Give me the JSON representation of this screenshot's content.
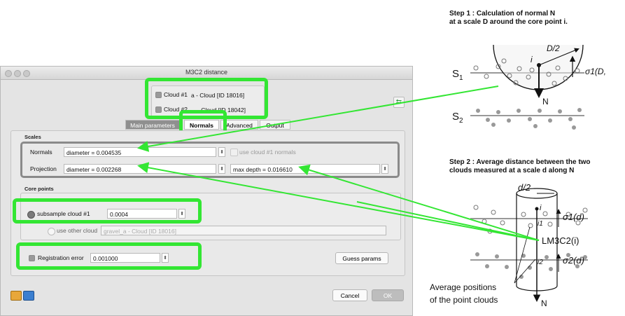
{
  "dialog": {
    "title": "M3C2 distance",
    "cloud1_label": "Cloud #1",
    "cloud1_value": "a - Cloud [ID 18016]",
    "cloud2_label": "Cloud #2",
    "cloud2_value": "- Cloud [ID 18042]",
    "tabs": [
      "Main parameters",
      "Normals",
      "Advanced",
      "Output"
    ],
    "scales_heading": "Scales",
    "normals_label": "Normals",
    "normals_value": "diameter = 0.004535",
    "use_cloud_normals": "use cloud #1 normals",
    "projection_label": "Projection",
    "projection_value": "diameter = 0.002268",
    "max_depth_value": "max depth = 0.016610",
    "core_points_heading": "Core points",
    "subsample_label": "subsample cloud #1",
    "subsample_value": "0.0004",
    "use_other_cloud_label": "use other cloud",
    "other_cloud_value": "gravel_a - Cloud [ID 18016]",
    "registration_label": "Registration error",
    "registration_value": "0.001000",
    "guess_params_button": "Guess params",
    "cancel_button": "Cancel",
    "ok_button": "OK"
  },
  "figure": {
    "step1_line1": "Step 1 : Calculation of normal N",
    "step1_line2": "at a scale D around the core point i.",
    "step2_line1": "Step 2 : Average distance between the two",
    "step2_line2": "clouds measured at a scale d along N",
    "s1": "S",
    "s1_sub": "1",
    "s2": "S",
    "s2_sub": "2",
    "d_half_big": "D/2",
    "sigma1_big": "σ1(D,",
    "n_big": "N",
    "i_big": "i",
    "d_half_small": "d/2",
    "i_small": "i",
    "i1": "i1",
    "i2": "i2",
    "sigma1_small": "σ1(d)",
    "sigma2_small": "σ2(d)",
    "lm3c2": "LM3C2(i)",
    "n_small": "N",
    "avg_line1": "Average positions",
    "avg_line2": "of the point clouds"
  },
  "colors": {
    "highlight": "#33e633",
    "arrow": "#33e633"
  }
}
